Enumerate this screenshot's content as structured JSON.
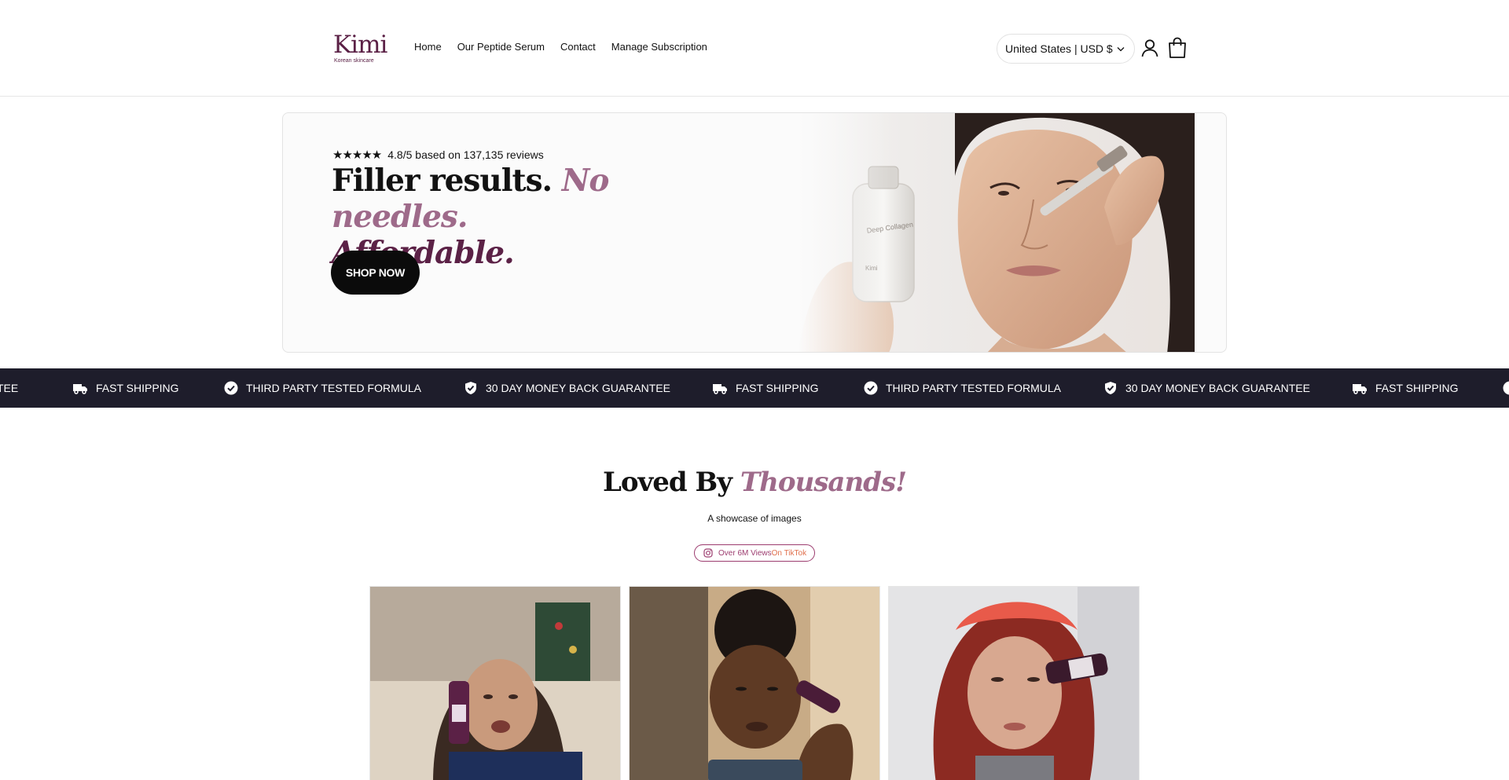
{
  "header": {
    "logo_text": "Kimi",
    "logo_sub": "Korean skincare",
    "nav": [
      {
        "label": "Home"
      },
      {
        "label": "Our Peptide Serum"
      },
      {
        "label": "Contact"
      },
      {
        "label": "Manage Subscription"
      }
    ],
    "currency_selected": "United States | USD $",
    "icons": [
      "chevron-down-icon",
      "account-icon",
      "cart-icon"
    ]
  },
  "hero": {
    "stars": "★★★★★",
    "rating_text": "4.8/5 based on 137,135 reviews",
    "headline_part1": "Filler results.",
    "headline_part2": "No needles.",
    "headline_part3": "Affordable.",
    "button_label": "SHOP NOW"
  },
  "marquee": {
    "items": [
      {
        "icon": "checkmark-badge-icon",
        "label": "TEE"
      },
      {
        "icon": "truck-icon",
        "label": "FAST SHIPPING"
      },
      {
        "icon": "check-circle-icon",
        "label": "THIRD PARTY TESTED FORMULA"
      },
      {
        "icon": "shield-check-icon",
        "label": "30 DAY MONEY BACK GUARANTEE"
      },
      {
        "icon": "truck-icon",
        "label": "FAST SHIPPING"
      },
      {
        "icon": "check-circle-icon",
        "label": "THIRD PARTY TESTED FORMULA"
      },
      {
        "icon": "shield-check-icon",
        "label": "30 DAY MONEY BACK GUARANTEE"
      },
      {
        "icon": "truck-icon",
        "label": "FAST SHIPPING"
      }
    ]
  },
  "showcase": {
    "title_part1": "Loved By",
    "title_part2": "Thousands!",
    "subtitle": "A showcase of images",
    "badge_part1": "Over 6M Views ",
    "badge_part2": "On TikTok"
  },
  "colors": {
    "brand": "#5b2146",
    "accent": "#9e6a8a",
    "marquee_bg": "#1e1d2b",
    "button_bg": "#0b0b0b"
  }
}
